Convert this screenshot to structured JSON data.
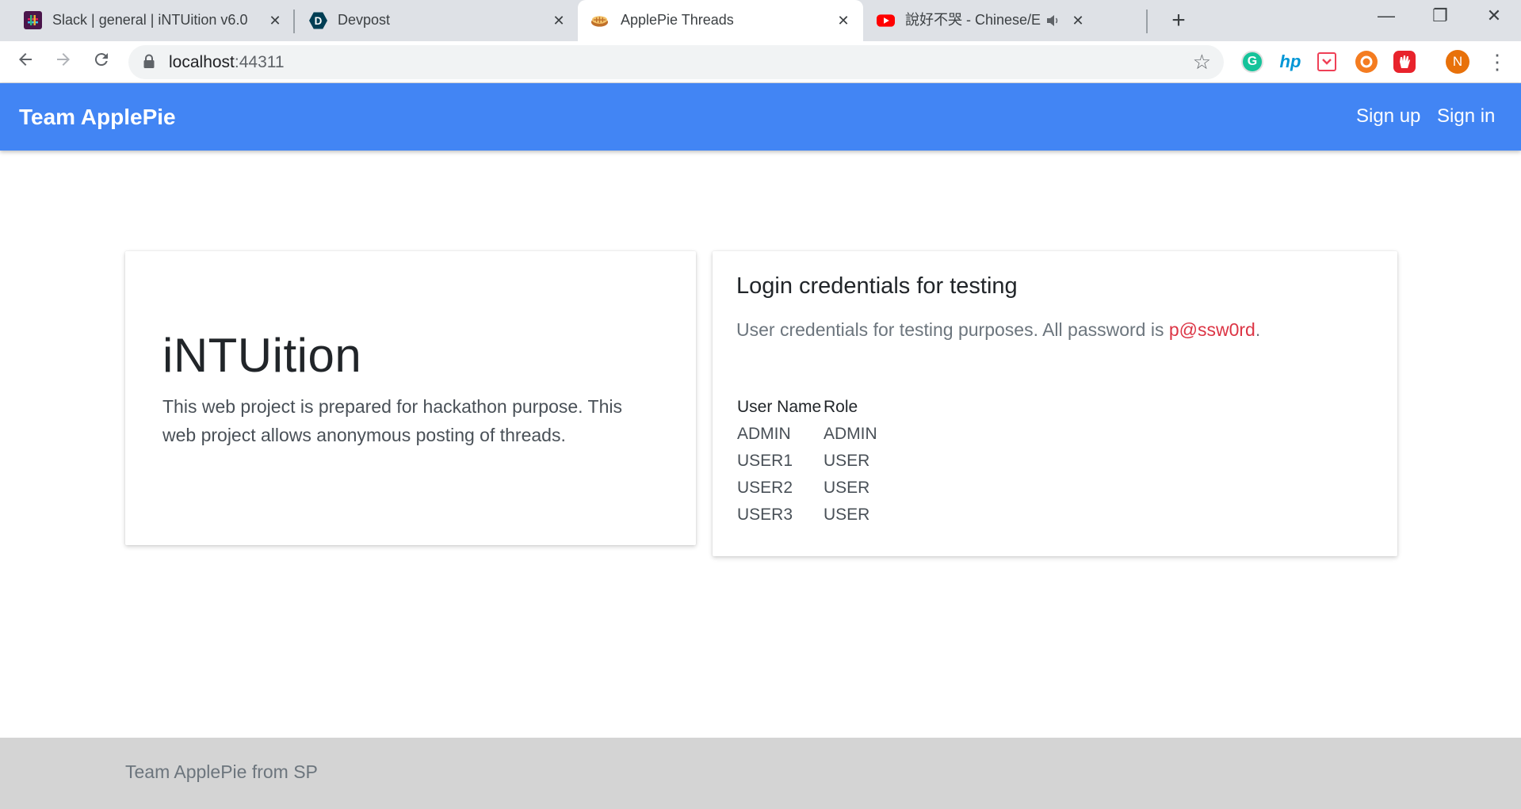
{
  "browser": {
    "tabs": [
      {
        "title": "Slack | general | iNTUition v6.0",
        "icon": "slack-icon"
      },
      {
        "title": "Devpost",
        "icon": "devpost-icon"
      },
      {
        "title": "ApplePie Threads",
        "icon": "pie-icon",
        "active": true
      },
      {
        "title": "說好不哭 - Chinese/English D",
        "icon": "youtube-icon",
        "audio": true
      }
    ],
    "close_glyph": "✕",
    "new_tab_glyph": "+",
    "window_controls": {
      "minimize": "—",
      "restore": "❐",
      "close": "✕"
    },
    "url_host": "localhost",
    "url_port": ":44311",
    "profile_initial": "N",
    "extensions": [
      "grammarly-icon",
      "hp-icon",
      "pocket-icon",
      "extension-icon",
      "adblock-icon"
    ]
  },
  "navbar": {
    "brand": "Team ApplePie",
    "links": {
      "signup": "Sign up",
      "signin": "Sign in"
    }
  },
  "intro": {
    "title": "iNTUition",
    "text": "This web project is prepared for hackathon purpose. This web project allows anonymous posting of threads."
  },
  "credentials": {
    "title": "Login credentials for testing",
    "text_before": "User credentials for testing purposes. All password is ",
    "password": "p@ssw0rd",
    "text_after": ".",
    "columns": {
      "username": "User Name",
      "role": "Role"
    },
    "rows": [
      {
        "username": "ADMIN",
        "role": "ADMIN"
      },
      {
        "username": "USER1",
        "role": "USER"
      },
      {
        "username": "USER2",
        "role": "USER"
      },
      {
        "username": "USER3",
        "role": "USER"
      }
    ]
  },
  "footer": {
    "text": "Team ApplePie from SP"
  },
  "colors": {
    "navbar": "#4285f4",
    "password": "#dc3545",
    "footer": "#d4d4d4"
  }
}
